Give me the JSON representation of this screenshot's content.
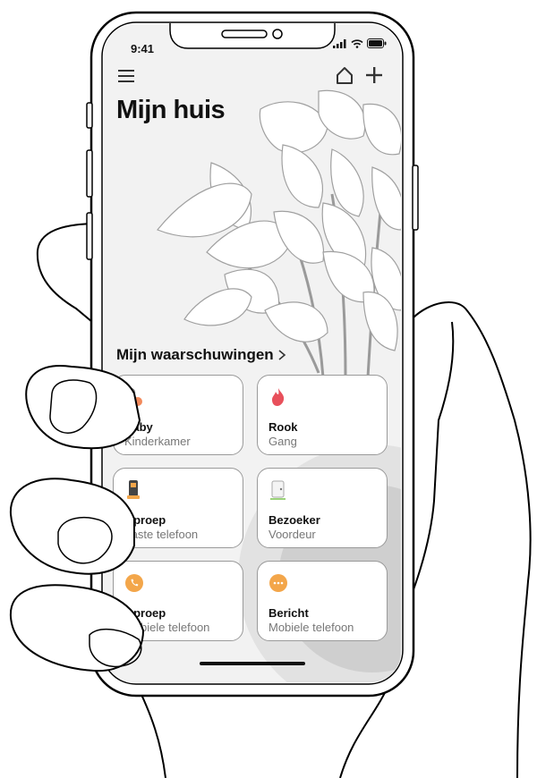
{
  "status": {
    "time": "9:41"
  },
  "header": {
    "title": "Mijn huis"
  },
  "alerts": {
    "section_label": "Mijn waarschuwingen",
    "items": [
      {
        "title": "Baby",
        "subtitle": "Kinderkamer",
        "icon": "pacifier-icon"
      },
      {
        "title": "Rook",
        "subtitle": "Gang",
        "icon": "flame-icon"
      },
      {
        "title": "Oproep",
        "subtitle": "Vaste telefoon",
        "icon": "landline-phone-icon"
      },
      {
        "title": "Bezoeker",
        "subtitle": "Voordeur",
        "icon": "doorbell-icon"
      },
      {
        "title": "Oproep",
        "subtitle": "Mobiele telefoon",
        "icon": "mobile-call-icon"
      },
      {
        "title": "Bericht",
        "subtitle": "Mobiele telefoon",
        "icon": "message-icon"
      }
    ]
  },
  "colors": {
    "accent_orange": "#f3a64a",
    "flame_red": "#e8505b",
    "card_border": "#9a9a9a"
  }
}
